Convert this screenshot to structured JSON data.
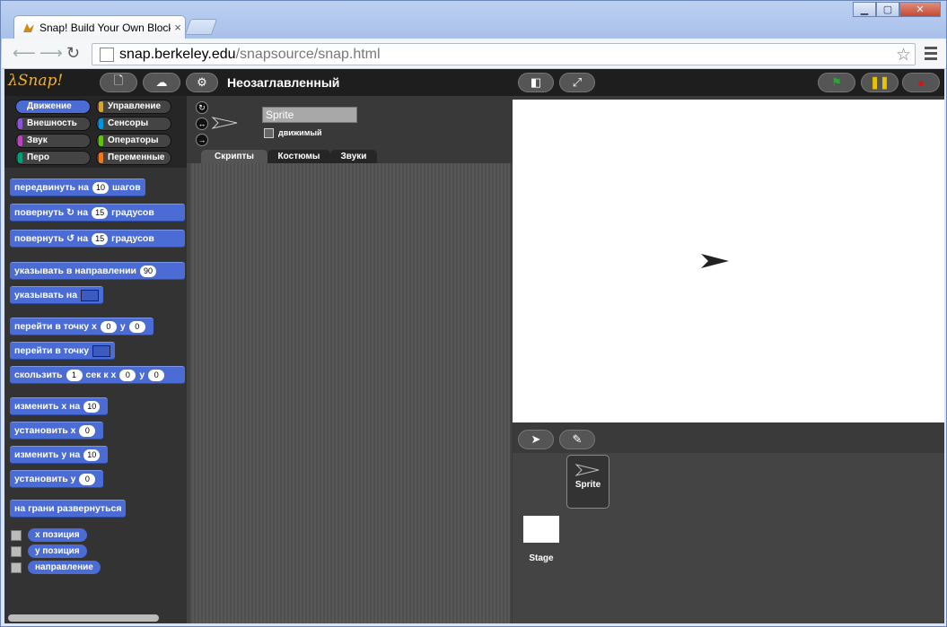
{
  "browser": {
    "tab_title": "Snap! Build Your Own Blocks",
    "tab_close": "×",
    "url_host": "snap.berkeley.edu",
    "url_path": "/snapsource/snap.html"
  },
  "snap": {
    "logo": "λSnap!",
    "project_title": "Неозаглавленный",
    "colors": {
      "motion": "#4a6cd4",
      "green_flag": "#22aa33",
      "pause": "#e8c400",
      "stop": "#dd1111"
    }
  },
  "categories": [
    {
      "label": "Движение",
      "color": "#4a6cd4",
      "selected": true
    },
    {
      "label": "Управление",
      "color": "#d8a23b",
      "selected": false
    },
    {
      "label": "Внешность",
      "color": "#8a55d7",
      "selected": false
    },
    {
      "label": "Сенсоры",
      "color": "#0494dc",
      "selected": false
    },
    {
      "label": "Звук",
      "color": "#bb42c3",
      "selected": false
    },
    {
      "label": "Операторы",
      "color": "#62c213",
      "selected": false
    },
    {
      "label": "Перо",
      "color": "#00a178",
      "selected": false
    },
    {
      "label": "Переменные",
      "color": "#f3761d",
      "selected": false
    }
  ],
  "blocks": {
    "move": {
      "a": "передвинуть на",
      "v": "10",
      "b": "шагов"
    },
    "turn_cw": {
      "a": "повернуть",
      "b": "на",
      "v": "15",
      "c": "градусов"
    },
    "turn_ccw": {
      "a": "повернуть",
      "b": "на",
      "v": "15",
      "c": "градусов"
    },
    "point_dir": {
      "a": "указывать в направлении",
      "v": "90"
    },
    "point_towards": {
      "a": "указывать на"
    },
    "goto_xy": {
      "a": "перейти в точку x",
      "x": "0",
      "b": "y",
      "y": "0"
    },
    "goto": {
      "a": "перейти в точку"
    },
    "glide": {
      "a": "скользить",
      "v": "1",
      "b": "сек к x",
      "x": "0",
      "c": "y",
      "y": "0"
    },
    "change_x": {
      "a": "изменить x на",
      "v": "10"
    },
    "set_x": {
      "a": "установить x",
      "v": "0"
    },
    "change_y": {
      "a": "изменить y на",
      "v": "10"
    },
    "set_y": {
      "a": "установить y",
      "v": "0"
    },
    "bounce": {
      "a": "на грани развернуться"
    },
    "reporters": [
      "x позиция",
      "y позиция",
      "направление"
    ]
  },
  "sprite": {
    "name": "Sprite",
    "draggable_label": "движимый",
    "tabs": [
      "Скрипты",
      "Костюмы",
      "Звуки"
    ]
  },
  "corral": {
    "sprite_label": "Sprite",
    "stage_label": "Stage"
  }
}
